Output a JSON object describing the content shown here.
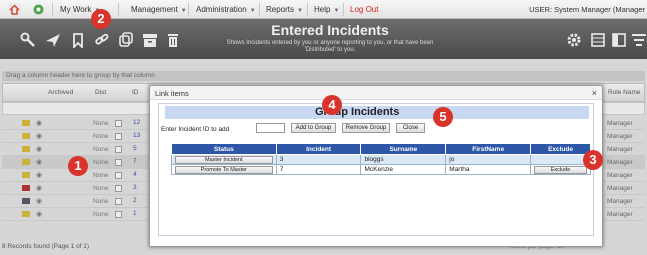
{
  "nav": {
    "menus": [
      {
        "label": "My Work"
      },
      {
        "label": "Management"
      },
      {
        "label": "Administration"
      },
      {
        "label": "Reports"
      },
      {
        "label": "Help"
      }
    ],
    "logout": "Log Out",
    "user": "USER: System Manager (Manager",
    "colors": {
      "logout": "#d9231d",
      "callout": "#d9342b"
    }
  },
  "toolbar": {
    "title": "Entered Incidents",
    "subtitle": "Shows Incidents entered by you or anyone reporting to you, or that have been 'Distributed' to you.",
    "icons": [
      "wrench-icon",
      "send-icon",
      "bookmark-icon",
      "link-icon",
      "copy-icon",
      "archive-icon",
      "delete-icon",
      "settings-icon",
      "grid-icon",
      "columns-icon",
      "filter-icon"
    ]
  },
  "grid": {
    "group_hint": "Drag a column header here to group by that column",
    "headers": {
      "archived": "Archived",
      "dist": "Dist",
      "id": "ID",
      "role": "Role Name"
    },
    "rows": [
      {
        "none": "None",
        "num": "12",
        "role": "Manager"
      },
      {
        "none": "None",
        "num": "13",
        "role": "Manager"
      },
      {
        "none": "None",
        "num": "5",
        "role": "Manager"
      },
      {
        "none": "None",
        "num": "7",
        "role": "Manager"
      },
      {
        "none": "None",
        "num": "4",
        "role": "Manager"
      },
      {
        "none": "None",
        "num": "3",
        "role": "Manager"
      },
      {
        "none": "None",
        "num": "2",
        "role": "Manager"
      },
      {
        "none": "None",
        "num": "1",
        "role": "Manager"
      }
    ],
    "footer": "8 Records found (Page 1 of 1)",
    "page_size": "Items per page: 10"
  },
  "modal": {
    "title": "Link items",
    "close": "×",
    "group_title": "Group Incidents",
    "add_label": "Enter Incident ID to add",
    "add_value": "",
    "buttons": {
      "add": "Add to Group",
      "remove": "Remove Group",
      "close": "Close"
    },
    "columns": [
      "Status",
      "Incident",
      "Surname",
      "FirstName",
      "Exclude"
    ],
    "rows": [
      {
        "status": "Master Incident",
        "incident": "3",
        "surname": "bloggs",
        "firstname": "jo",
        "exclude": ""
      },
      {
        "status": "Promote To Master",
        "incident": "7",
        "surname": "McKenzie",
        "firstname": "Martha",
        "exclude": "Exclude"
      }
    ]
  },
  "callouts": [
    "1",
    "2",
    "3",
    "4",
    "5"
  ]
}
